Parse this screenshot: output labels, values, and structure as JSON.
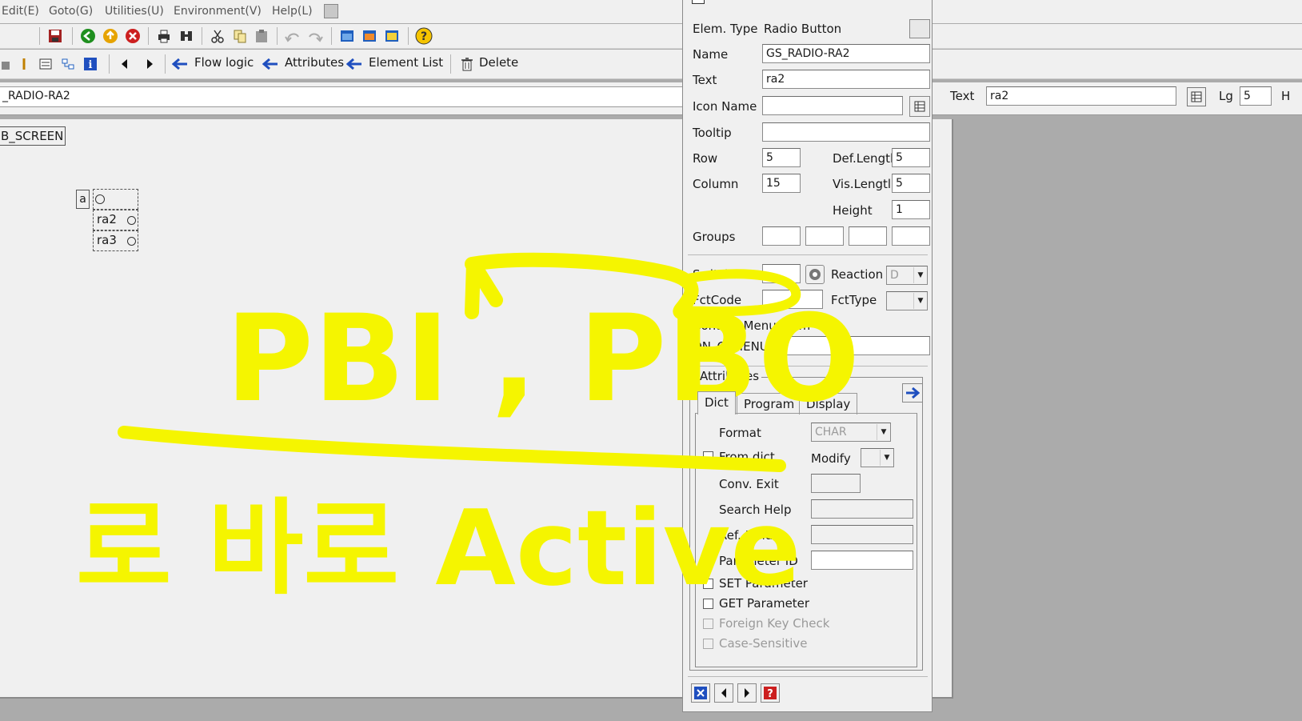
{
  "menu": [
    "Edit(E)",
    "Goto(G)",
    "Utilities(U)",
    "Environment(V)",
    "Help(L)"
  ],
  "app_toolbar": {
    "flow_logic": "Flow logic",
    "attributes": "Attributes",
    "element_list": "Element List",
    "delete": "Delete"
  },
  "name_bar": {
    "element_name": "_RADIO-RA2",
    "text_label": "Text",
    "text_value": "ra2",
    "lg_label": "Lg",
    "lg_value": "5",
    "h_label": "H"
  },
  "canvas": {
    "frame_label": "B_SCREEN",
    "radio_group_label": "a",
    "radio_items": [
      "ra2",
      "ra3"
    ],
    "annotation": {
      "line1": "PBI , PBO",
      "line2": "로 바로 Active",
      "color": "#f5f500"
    }
  },
  "panel": {
    "elem_type_label": "Elem. Type",
    "elem_type_value": "Radio Button",
    "name_label": "Name",
    "name_value": "GS_RADIO-RA2",
    "text_label": "Text",
    "text_value": "ra2",
    "icon_name_label": "Icon Name",
    "tooltip_label": "Tooltip",
    "row_label": "Row",
    "row_value": "5",
    "column_label": "Column",
    "column_value": "15",
    "def_length_label": "Def.Lengtl",
    "def_length_value": "5",
    "vis_length_label": "Vis.Lengtl",
    "vis_length_value": "5",
    "height_label": "Height",
    "height_value": "1",
    "groups_label": "Groups",
    "switch_label": "Switch",
    "reaction_label": "Reaction",
    "reaction_value": "D",
    "fctcode_label": "FctCode",
    "fcttype_label": "FctType",
    "context_menu_label": "Context Menu Form",
    "on_ctmenu_label": "ON_CTMENU_",
    "attributes_group": "Attributes",
    "tabs": [
      "Dict",
      "Program",
      "Display"
    ],
    "format_label": "Format",
    "format_value": "CHAR",
    "from_dict_label": "From dict.",
    "modify_label": "Modify",
    "conv_exit_label": "Conv. Exit",
    "search_help_label": "Search Help",
    "ref_field_label": "Ref. Field",
    "parameter_id_label": "Parameter ID",
    "set_parameter_label": "SET Parameter",
    "get_parameter_label": "GET Parameter",
    "foreign_key_label": "Foreign Key Check",
    "case_sensitive_label": "Case-Sensitive"
  }
}
